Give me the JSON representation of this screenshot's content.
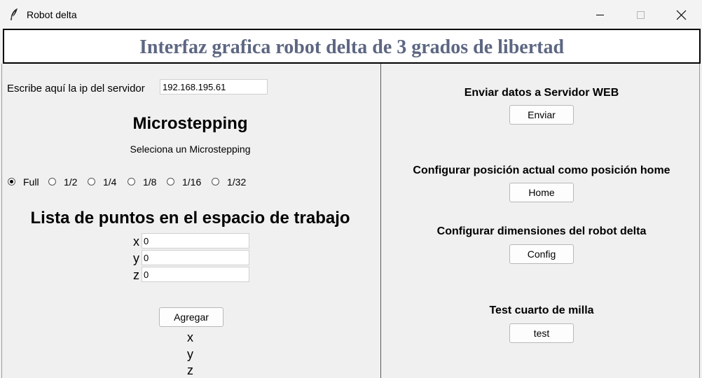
{
  "window": {
    "title": "Robot delta"
  },
  "banner": {
    "title": "Interfaz grafica robot delta de 3 grados de libertad"
  },
  "left": {
    "ip_label": "Escribe aquí la ip del servidor",
    "ip_value": "192.168.195.61",
    "micro_title": "Microstepping",
    "micro_subtitle": "Seleciona un Microstepping",
    "micro_options": [
      "Full",
      "1/2",
      "1/4",
      "1/8",
      "1/16",
      "1/32"
    ],
    "micro_selected": "Full",
    "list_title": "Lista de puntos en el espacio de trabajo",
    "coords": {
      "x_label": "x",
      "x_value": "0",
      "y_label": "y",
      "y_value": "0",
      "z_label": "z",
      "z_value": "0"
    },
    "add_button": "Agregar",
    "output_labels": [
      "x",
      "y",
      "z"
    ]
  },
  "right": {
    "send_label": "Enviar datos a Servidor WEB",
    "send_button": "Enviar",
    "home_label": "Configurar posición actual como posición home",
    "home_button": "Home",
    "config_label": "Configurar dimensiones del robot delta",
    "config_button": "Config",
    "test_label": "Test cuarto de milla",
    "test_button": "test"
  },
  "icons": {
    "app": "feather-icon",
    "minimize": "minimize-icon",
    "maximize": "maximize-icon",
    "close": "close-icon"
  }
}
